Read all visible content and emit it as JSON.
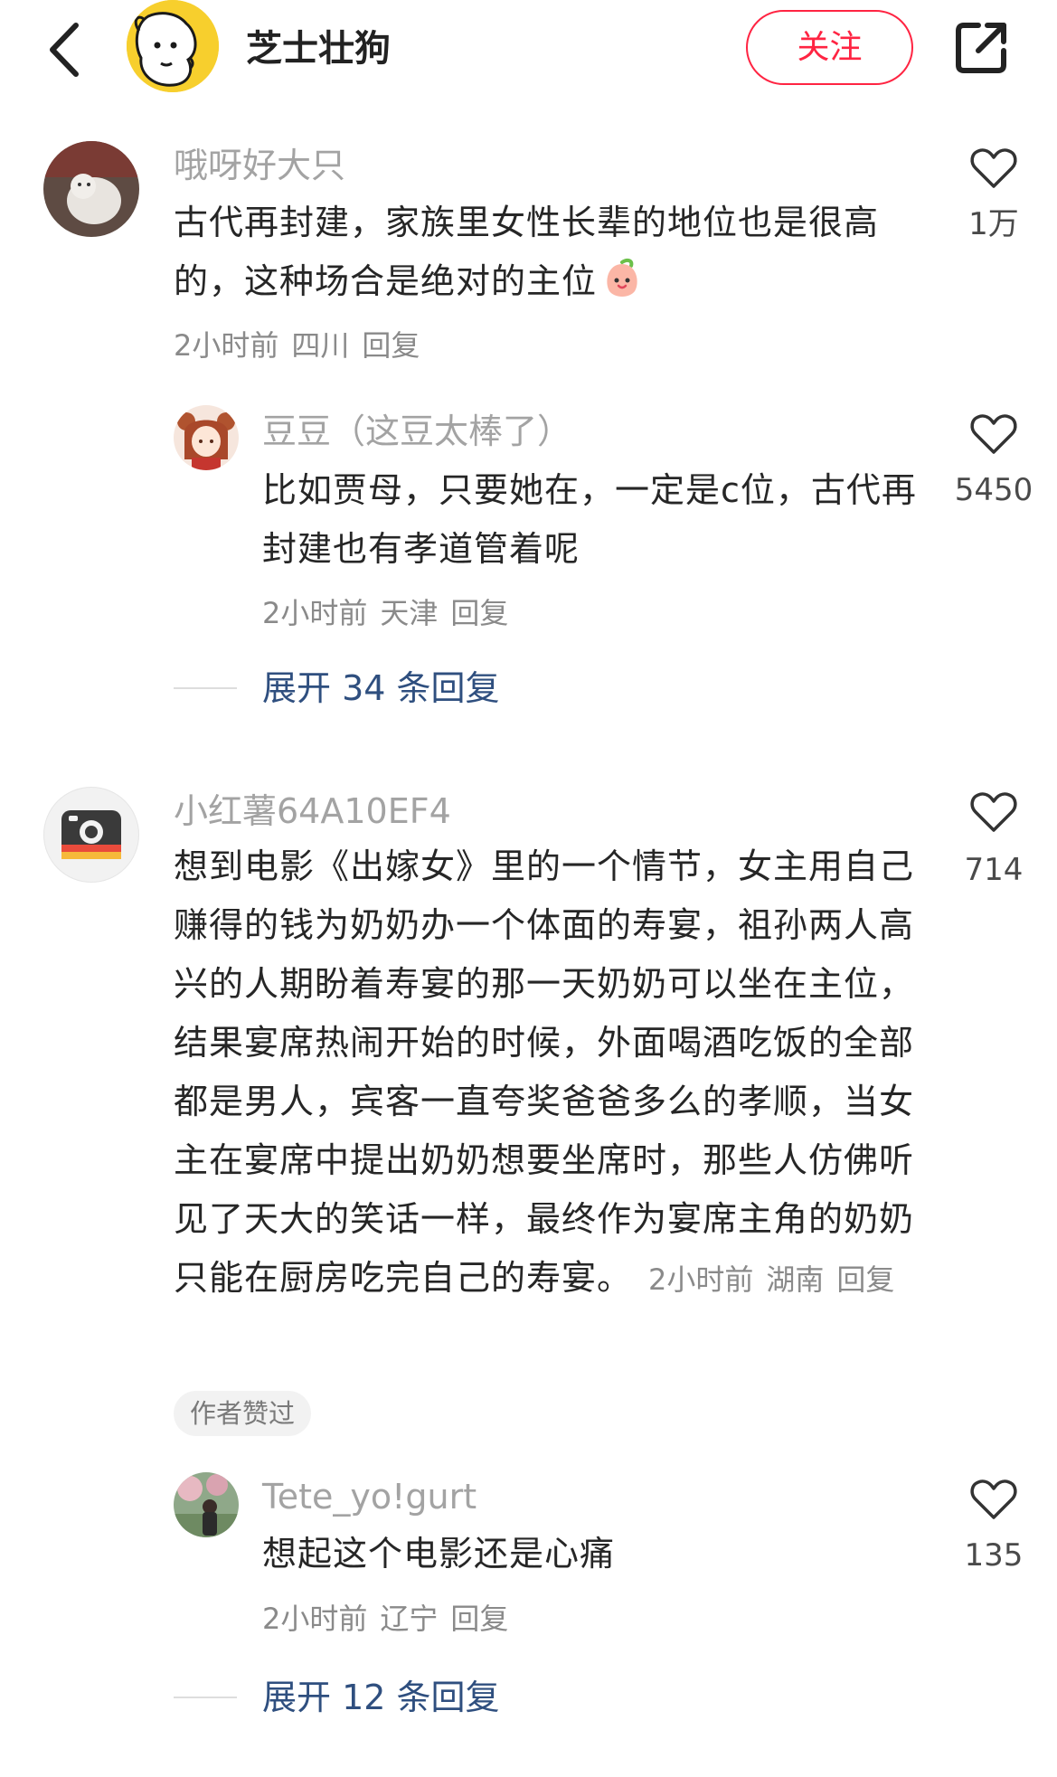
{
  "header": {
    "name": "芝士壮狗",
    "follow_label": "关注",
    "accent": "#ff2442",
    "avatar_bg": "#f7cf2d"
  },
  "comments": [
    {
      "user": "哦呀好大只",
      "text": "古代再封建，家族里女性长辈的地位也是很高的，这种场合是绝对的主位",
      "emoji": "peach-face-emoji",
      "time": "2小时前",
      "location": "四川",
      "reply_label": "回复",
      "likes": "1万",
      "replies": [
        {
          "user": "豆豆（这豆太棒了）",
          "text": "比如贾母，只要她在，一定是c位，古代再封建也有孝道管着呢",
          "time": "2小时前",
          "location": "天津",
          "reply_label": "回复",
          "likes": "5450"
        }
      ],
      "expand_label": "展开 34 条回复"
    },
    {
      "user": "小红薯64A10EF4",
      "text": "想到电影《出嫁女》里的一个情节，女主用自己赚得的钱为奶奶办一个体面的寿宴，祖孙两人高兴的人期盼着寿宴的那一天奶奶可以坐在主位，结果宴席热闹开始的时候，外面喝酒吃饭的全部都是男人，宾客一直夸奖爸爸多么的孝顺，当女主在宴席中提出奶奶想要坐席时，那些人仿佛听见了天大的笑话一样，最终作为宴席主角的奶奶只能在厨房吃完自己的寿宴。",
      "time": "2小时前",
      "location": "湖南",
      "reply_label": "回复",
      "likes": "714",
      "author_badge": "作者赞过",
      "replies": [
        {
          "user": "Tete_yo!gurt",
          "text": "想起这个电影还是心痛",
          "time": "2小时前",
          "location": "辽宁",
          "reply_label": "回复",
          "likes": "135"
        }
      ],
      "expand_label": "展开 12 条回复"
    }
  ]
}
